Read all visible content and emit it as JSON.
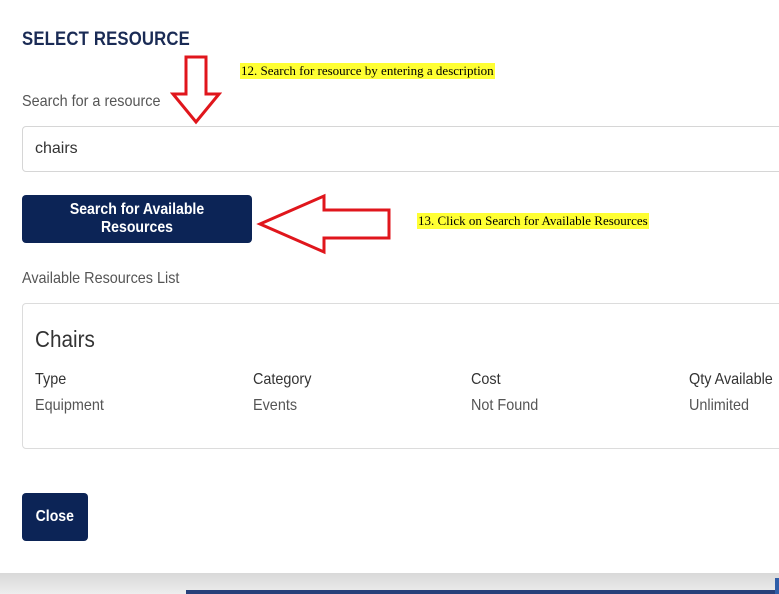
{
  "modal": {
    "title": "SELECT RESOURCE",
    "search_label": "Search for a resource",
    "search_value": "chairs",
    "search_button_label": "Search for Available Resources",
    "list_label": "Available Resources List",
    "close_button_label": "Close"
  },
  "resource": {
    "name": "Chairs",
    "columns": [
      {
        "header": "Type",
        "value": "Equipment"
      },
      {
        "header": "Category",
        "value": "Events"
      },
      {
        "header": "Cost",
        "value": "Not Found"
      },
      {
        "header": "Qty Available",
        "value": "Unlimited"
      }
    ]
  },
  "annotations": {
    "step12": "12. Search for resource by entering a description",
    "step13": "13. Click on Search for Available Resources"
  },
  "colors": {
    "primary_button": "#0c2456",
    "title": "#1a2b55",
    "annotation_highlight": "#ffff33",
    "arrow": "#e0161c"
  },
  "icons": {
    "down_arrow": "down-arrow-icon",
    "left_arrow": "left-arrow-icon"
  }
}
